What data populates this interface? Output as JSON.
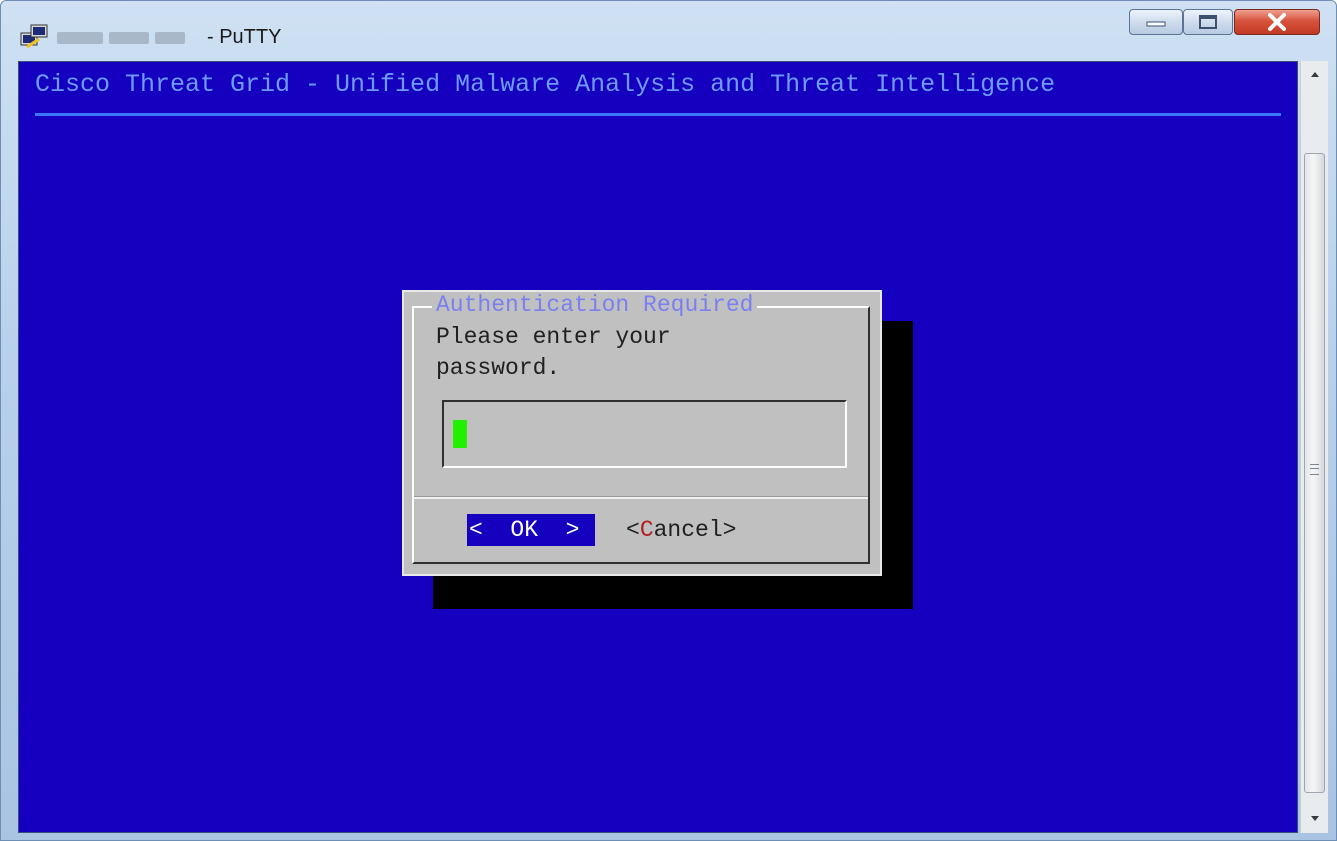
{
  "window": {
    "title_suffix": "- PuTTY"
  },
  "terminal": {
    "header": "Cisco Threat Grid - Unified Malware Analysis and Threat Intelligence"
  },
  "dialog": {
    "title": "Authentication Required",
    "message": "Please enter your password.",
    "password_value": "",
    "ok_label": "<  OK  >",
    "cancel_open": "<",
    "cancel_hotkey": "C",
    "cancel_rest": "ancel>"
  },
  "colors": {
    "terminal_bg": "#1500c0",
    "header_text": "#6f9bff",
    "dialog_bg": "#c0c0c0",
    "cursor": "#22f000",
    "hotkey": "#b21e1e"
  },
  "icons": [
    "putty-icon",
    "minimize-icon",
    "maximize-icon",
    "close-icon",
    "scroll-up-arrow-icon",
    "scroll-down-arrow-icon",
    "scroll-grip-icon"
  ]
}
